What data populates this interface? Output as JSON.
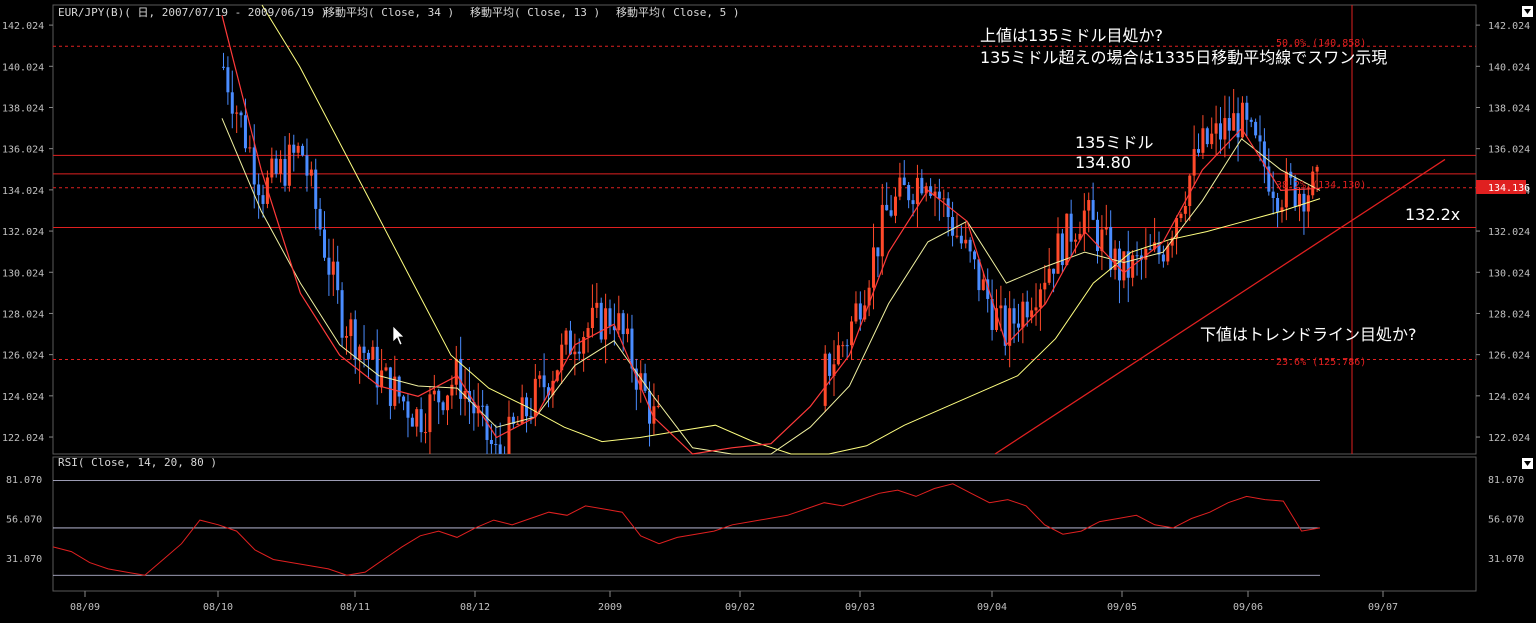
{
  "header": {
    "symbol": "EUR/JPY(B)( 日, 2007/07/19 - 2009/06/19 )",
    "ma1": "移動平均( Close, 34 )",
    "ma2": "移動平均( Close, 13 )",
    "ma3": "移動平均( Close, 5 )"
  },
  "rsi_header": "RSI( Close, 14, 20, 80 )",
  "annotations": {
    "top_line1": "上値は135ミドル目処か?",
    "top_line2": "135ミドル超えの場合は1335日移動平均線でスワン示現",
    "mid_label": "135ミドル",
    "level_label": "134.80",
    "right_label": "132.2x",
    "bottom_note": "下値はトレンドライン目処か?",
    "fib_50": "50.0% (140.858)",
    "fib_382": "38.2% (134.130)",
    "fib_236": "23.6% (125.786)",
    "last_price": "134.136"
  },
  "colors": {
    "up": "#ff4a2a",
    "down": "#4a8cff",
    "ma34": "#ffff80",
    "ma13": "#f0f0a0",
    "ma5": "#ff3a3a",
    "hline": "#e02020",
    "rsi": "#e02020",
    "axis_text": "#c0c0c0"
  },
  "chart_data": [
    {
      "type": "candlestick",
      "title": "EUR/JPY(B)( 日, 2007/07/19 - 2009/06/19 )",
      "y_ticks": [
        "142.024",
        "140.024",
        "138.024",
        "136.024",
        "134.024",
        "132.024",
        "130.024",
        "128.024",
        "126.024",
        "124.024",
        "122.024"
      ],
      "ylim": [
        121.2,
        143.0
      ],
      "x_ticks": [
        "08/09",
        "08/10",
        "08/11",
        "08/12",
        "2009",
        "09/02",
        "09/03",
        "09/04",
        "09/05",
        "09/06",
        "09/07"
      ],
      "horizontal_levels": [
        {
          "value": 135.7,
          "style": "solid"
        },
        {
          "value": 134.8,
          "style": "solid"
        },
        {
          "value": 132.2,
          "style": "solid"
        },
        {
          "value": 141.0,
          "style": "dashed"
        },
        {
          "value": 134.13,
          "style": "dashed"
        },
        {
          "value": 125.786,
          "style": "dashed"
        }
      ],
      "trendline": [
        {
          "x": "2009/03/15",
          "y": 121.2
        },
        {
          "x": "2009/07/01",
          "y": 135.5
        }
      ],
      "series": [
        {
          "name": "移動平均( Close, 34 )",
          "values": [
            143.0,
            140.0,
            136.5,
            133.0,
            129.5,
            126.0,
            124.4,
            123.5,
            122.5,
            121.8,
            122.0,
            122.3,
            122.6,
            121.8,
            121.2,
            121.0,
            121.6,
            122.6,
            123.4,
            124.2,
            125.0,
            126.8,
            129.5,
            131.0,
            131.6,
            132.0,
            132.5,
            133.0,
            133.6
          ]
        },
        {
          "name": "移動平均( Close, 13 )",
          "values": [
            137.5,
            133.0,
            129.5,
            126.5,
            125.0,
            124.5,
            124.4,
            122.5,
            123.0,
            125.5,
            126.7,
            124.0,
            121.5,
            121.0,
            121.2,
            122.5,
            124.5,
            128.5,
            131.5,
            132.5,
            129.5,
            130.3,
            131.0,
            130.5,
            131.0,
            133.5,
            136.5,
            135.0,
            134.0
          ]
        },
        {
          "name": "移動平均( Close, 5 )",
          "values": [
            142.5,
            135.0,
            129.0,
            126.0,
            124.5,
            124.0,
            125.0,
            122.0,
            123.0,
            126.5,
            127.5,
            123.0,
            121.0,
            121.5,
            121.7,
            123.5,
            126.0,
            131.0,
            134.0,
            132.5,
            126.5,
            128.5,
            132.0,
            130.0,
            131.5,
            135.0,
            137.0,
            134.0,
            134.1
          ]
        }
      ],
      "candle_path": [
        140,
        134,
        136,
        128,
        125,
        123,
        125,
        121,
        124,
        127,
        128,
        123,
        121,
        120,
        121,
        124,
        127,
        133,
        135,
        131,
        127,
        130,
        133,
        130,
        131,
        136,
        137.5,
        134,
        134.1
      ]
    },
    {
      "type": "line",
      "title": "RSI( Close, 14, 20, 80 )",
      "y_ticks": [
        "81.070",
        "56.070",
        "31.070"
      ],
      "ylim": [
        10,
        95
      ],
      "levels": [
        80,
        50,
        20
      ],
      "series": [
        {
          "name": "RSI( Close, 14, 20, 80 )",
          "values": [
            38,
            35,
            28,
            24,
            22,
            20,
            30,
            40,
            55,
            52,
            48,
            36,
            30,
            28,
            26,
            24,
            20,
            22,
            30,
            38,
            45,
            48,
            44,
            50,
            55,
            52,
            56,
            60,
            58,
            64,
            62,
            60,
            45,
            40,
            44,
            46,
            48,
            52,
            54,
            56,
            58,
            62,
            66,
            64,
            68,
            72,
            74,
            70,
            75,
            78,
            72,
            66,
            68,
            64,
            52,
            46,
            48,
            54,
            56,
            58,
            52,
            50,
            56,
            60,
            66,
            70,
            68,
            67,
            48,
            50
          ]
        }
      ]
    }
  ]
}
